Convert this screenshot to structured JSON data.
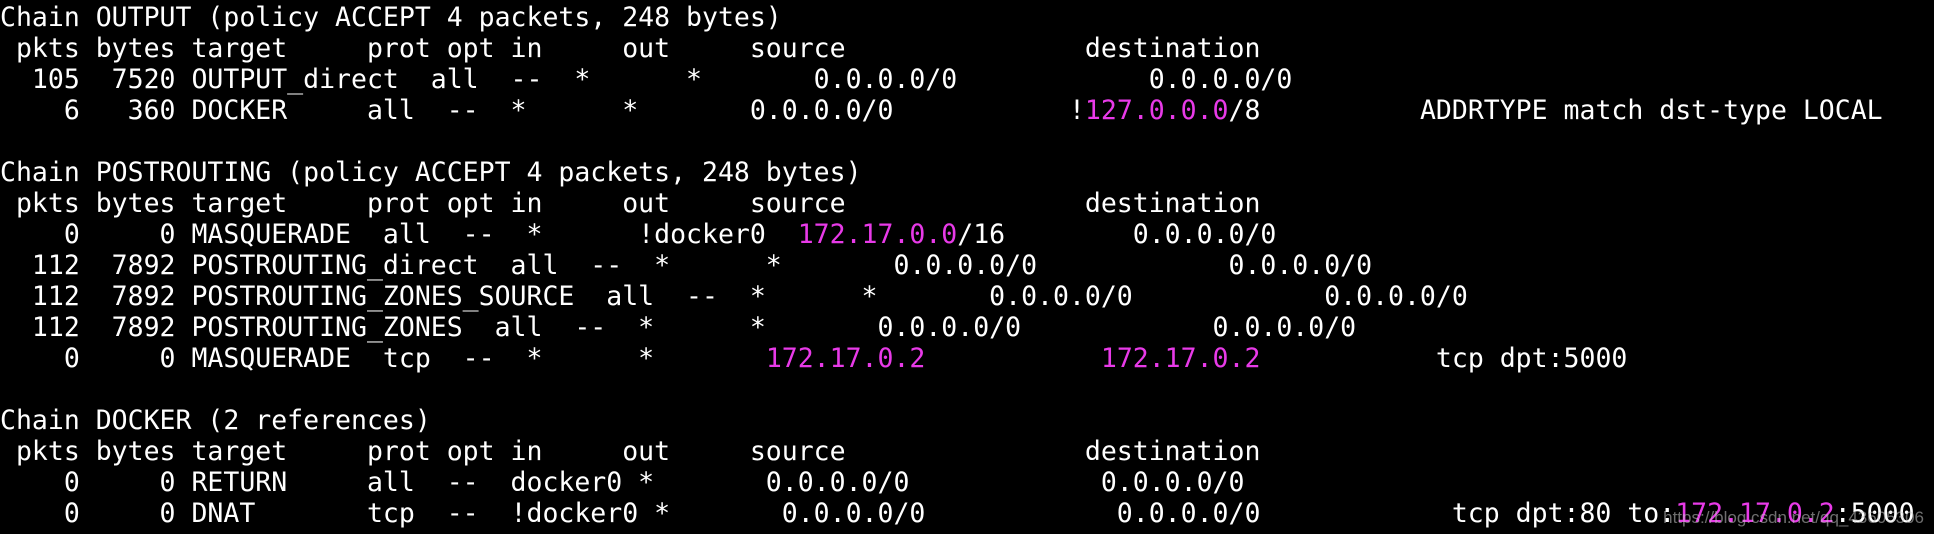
{
  "colors": {
    "background": "#000000",
    "text": "#ffffff",
    "highlight": "#e83ae8"
  },
  "terminal": {
    "lines": [
      {
        "segments": [
          {
            "t": "Chain OUTPUT (policy ACCEPT 4 packets, 248 bytes)"
          }
        ]
      },
      {
        "segments": [
          {
            "t": " pkts bytes target     prot opt in     out     source               destination"
          }
        ]
      },
      {
        "segments": [
          {
            "t": "  105  7520 OUTPUT_direct  all  --  *      *       0.0.0.0/0            0.0.0.0/0"
          }
        ]
      },
      {
        "segments": [
          {
            "t": "    6   360 DOCKER     all  --  *      *       0.0.0.0/0           !"
          },
          {
            "t": "127.0.0.0",
            "hl": true
          },
          {
            "t": "/8          ADDRTYPE match dst-type LOCAL"
          }
        ]
      },
      {
        "segments": [
          {
            "t": ""
          }
        ]
      },
      {
        "segments": [
          {
            "t": "Chain POSTROUTING (policy ACCEPT 4 packets, 248 bytes)"
          }
        ]
      },
      {
        "segments": [
          {
            "t": " pkts bytes target     prot opt in     out     source               destination"
          }
        ]
      },
      {
        "segments": [
          {
            "t": "    0     0 MASQUERADE  all  --  *      !docker0  "
          },
          {
            "t": "172.17.0.0",
            "hl": true
          },
          {
            "t": "/16        0.0.0.0/0"
          }
        ]
      },
      {
        "segments": [
          {
            "t": "  112  7892 POSTROUTING_direct  all  --  *      *       0.0.0.0/0            0.0.0.0/0"
          }
        ]
      },
      {
        "segments": [
          {
            "t": "  112  7892 POSTROUTING_ZONES_SOURCE  all  --  *      *       0.0.0.0/0            0.0.0.0/0"
          }
        ]
      },
      {
        "segments": [
          {
            "t": "  112  7892 POSTROUTING_ZONES  all  --  *      *       0.0.0.0/0            0.0.0.0/0"
          }
        ]
      },
      {
        "segments": [
          {
            "t": "    0     0 MASQUERADE  tcp  --  *      *       "
          },
          {
            "t": "172.17.0.2",
            "hl": true
          },
          {
            "t": "           "
          },
          {
            "t": "172.17.0.2",
            "hl": true
          },
          {
            "t": "           tcp dpt:5000"
          }
        ]
      },
      {
        "segments": [
          {
            "t": ""
          }
        ]
      },
      {
        "segments": [
          {
            "t": "Chain DOCKER (2 references)"
          }
        ]
      },
      {
        "segments": [
          {
            "t": " pkts bytes target     prot opt in     out     source               destination"
          }
        ]
      },
      {
        "segments": [
          {
            "t": "    0     0 RETURN     all  --  docker0 *       0.0.0.0/0            0.0.0.0/0"
          }
        ]
      },
      {
        "segments": [
          {
            "t": "    0     0 DNAT       tcp  --  !docker0 *       0.0.0.0/0            0.0.0.0/0            tcp dpt:80 to:"
          },
          {
            "t": "172.17.0.2",
            "hl": true
          },
          {
            "t": ":5000"
          }
        ]
      }
    ]
  },
  "watermark": "https://blog.csdn.net/qq_43605306"
}
